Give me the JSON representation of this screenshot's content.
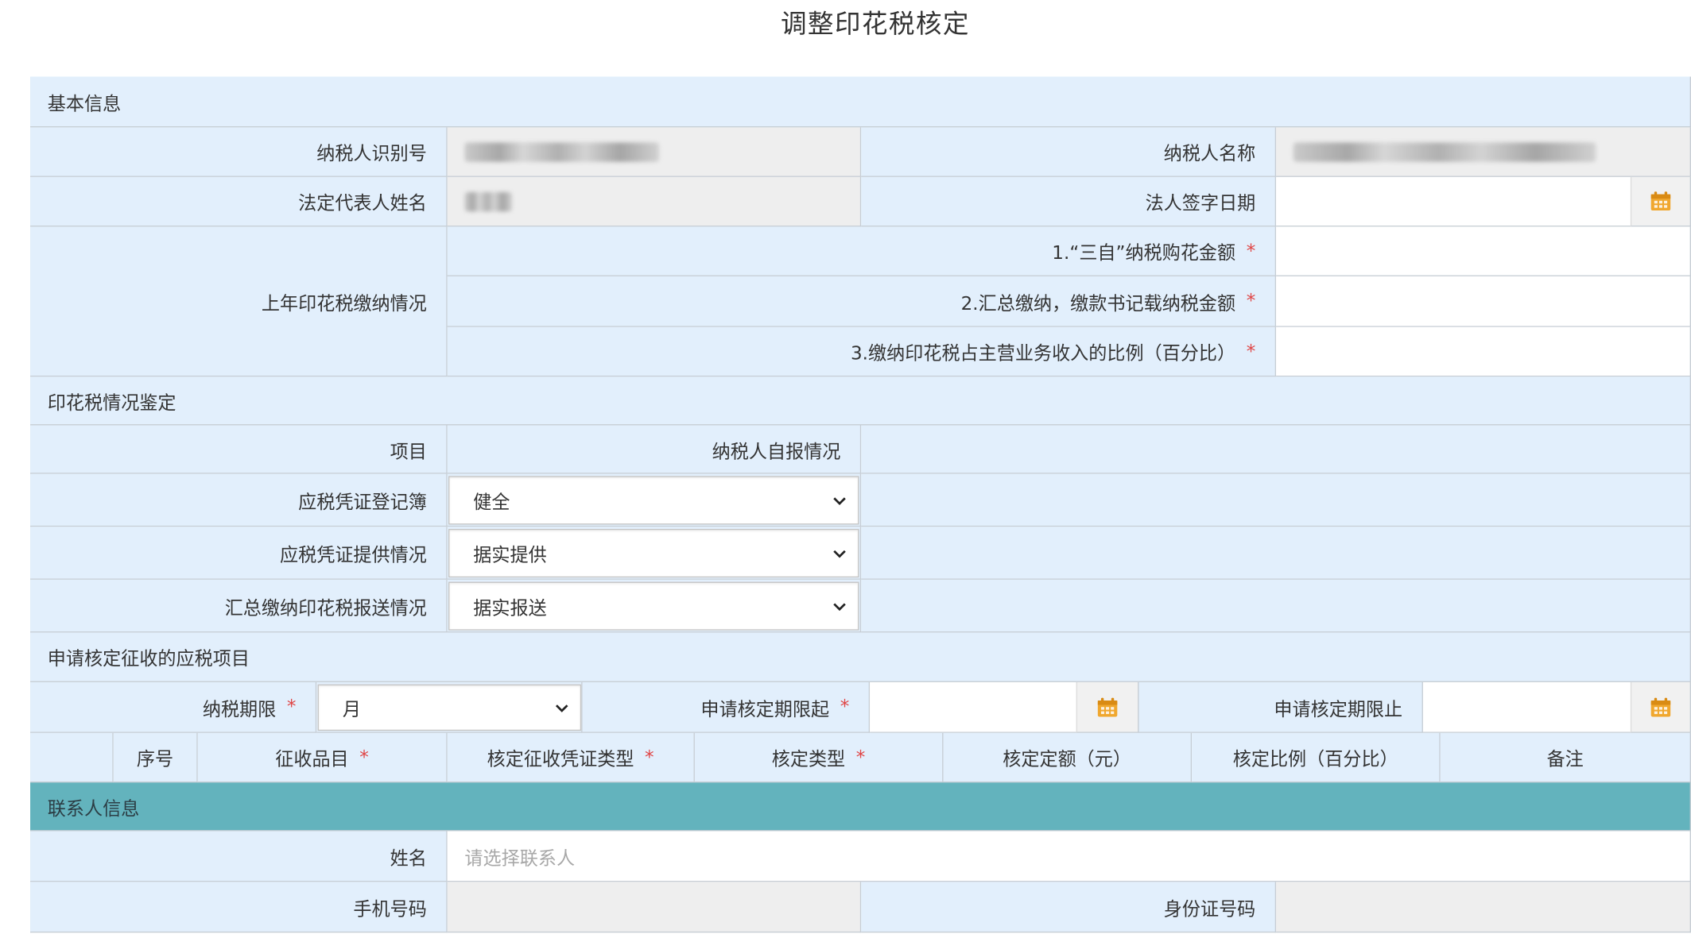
{
  "page_title": "调整印花税核定",
  "basic": {
    "section": "基本信息",
    "taxpayer_id_label": "纳税人识别号",
    "taxpayer_name_label": "纳税人名称",
    "legal_rep_label": "法定代表人姓名",
    "sign_date_label": "法人签字日期",
    "last_year_label": "上年印花税缴纳情况",
    "q1_label": "1.“三自”纳税购花金额",
    "q2_label": "2.汇总缴纳，缴款书记载纳税金额",
    "q3_label": "3.缴纳印花税占主营业务收入的比例（百分比）",
    "required_mark": "*"
  },
  "appraisal": {
    "section": "印花税情况鉴定",
    "item_header": "项目",
    "self_report_header": "纳税人自报情况",
    "rows": [
      {
        "label": "应税凭证登记簿",
        "value": "健全"
      },
      {
        "label": "应税凭证提供情况",
        "value": "据实提供"
      },
      {
        "label": "汇总缴纳印花税报送情况",
        "value": "据实报送"
      }
    ]
  },
  "items": {
    "section": "申请核定征收的应税项目",
    "period_label": "纳税期限",
    "period_value": "月",
    "start_label": "申请核定期限起",
    "end_label": "申请核定期限止",
    "columns": [
      "序号",
      "征收品目",
      "核定征收凭证类型",
      "核定类型",
      "核定定额（元）",
      "核定比例（百分比）",
      "备注"
    ]
  },
  "contact": {
    "section": "联系人信息",
    "name_label": "姓名",
    "name_placeholder": "请选择联系人",
    "phone_label": "手机号码",
    "id_label": "身份证号码"
  },
  "colors": {
    "header_bg": "#e2effc",
    "contact_header_bg": "#63b3bd",
    "readonly_bg": "#eeeeee",
    "required": "#e04545",
    "calendar_icon": "#f0a72e"
  },
  "icons": [
    "calendar-icon",
    "chevron-down-icon"
  ]
}
